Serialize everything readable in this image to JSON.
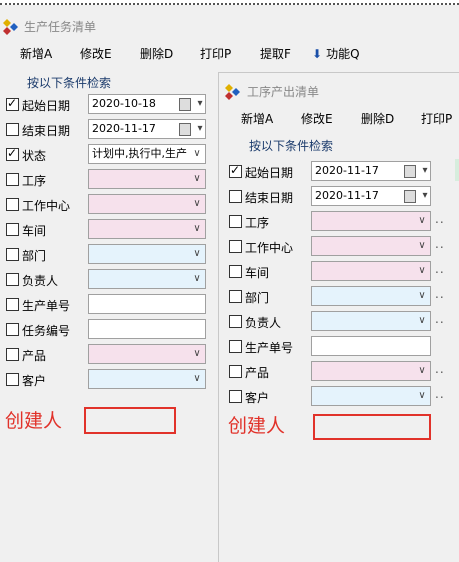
{
  "window1": {
    "title": "生产任务清单",
    "toolbar": [
      "新增A",
      "修改E",
      "删除D",
      "打印P",
      "提取F",
      "功能Q"
    ],
    "search_title": "按以下条件检索",
    "fields": [
      {
        "label": "起始日期",
        "checked": true,
        "value": "2020-10-18",
        "kind": "date"
      },
      {
        "label": "结束日期",
        "checked": false,
        "value": "2020-11-17",
        "kind": "date"
      },
      {
        "label": "状态",
        "checked": true,
        "value": "计划中,执行中,生产",
        "kind": "select"
      },
      {
        "label": "工序",
        "checked": false,
        "value": "",
        "kind": "pink"
      },
      {
        "label": "工作中心",
        "checked": false,
        "value": "",
        "kind": "pink"
      },
      {
        "label": "车间",
        "checked": false,
        "value": "",
        "kind": "pink"
      },
      {
        "label": "部门",
        "checked": false,
        "value": "",
        "kind": "blue"
      },
      {
        "label": "负责人",
        "checked": false,
        "value": "",
        "kind": "blue"
      },
      {
        "label": "生产单号",
        "checked": false,
        "value": "",
        "kind": "plain"
      },
      {
        "label": "任务编号",
        "checked": false,
        "value": "",
        "kind": "plain"
      },
      {
        "label": "产品",
        "checked": false,
        "value": "",
        "kind": "pink"
      },
      {
        "label": "客户",
        "checked": false,
        "value": "",
        "kind": "blue"
      }
    ],
    "annotation": "创建人"
  },
  "window2": {
    "title": "工序产出清单",
    "toolbar": [
      "新增A",
      "修改E",
      "删除D",
      "打印P"
    ],
    "search_title": "按以下条件检索",
    "fields": [
      {
        "label": "起始日期",
        "checked": true,
        "value": "2020-11-17",
        "kind": "date"
      },
      {
        "label": "结束日期",
        "checked": false,
        "value": "2020-11-17",
        "kind": "date"
      },
      {
        "label": "工序",
        "checked": false,
        "value": "",
        "kind": "pink"
      },
      {
        "label": "工作中心",
        "checked": false,
        "value": "",
        "kind": "pink"
      },
      {
        "label": "车间",
        "checked": false,
        "value": "",
        "kind": "pink"
      },
      {
        "label": "部门",
        "checked": false,
        "value": "",
        "kind": "blue"
      },
      {
        "label": "负责人",
        "checked": false,
        "value": "",
        "kind": "blue"
      },
      {
        "label": "生产单号",
        "checked": false,
        "value": "",
        "kind": "plain"
      },
      {
        "label": "产品",
        "checked": false,
        "value": "",
        "kind": "pink"
      },
      {
        "label": "客户",
        "checked": false,
        "value": "",
        "kind": "blue"
      }
    ],
    "annotation": "创建人",
    "ellipsis": ".."
  },
  "colors": {
    "annotation_red": "#e1322a",
    "pink_field": "#f6e1ec",
    "blue_field": "#e5f3fc",
    "search_title": "#1a3a6b"
  }
}
